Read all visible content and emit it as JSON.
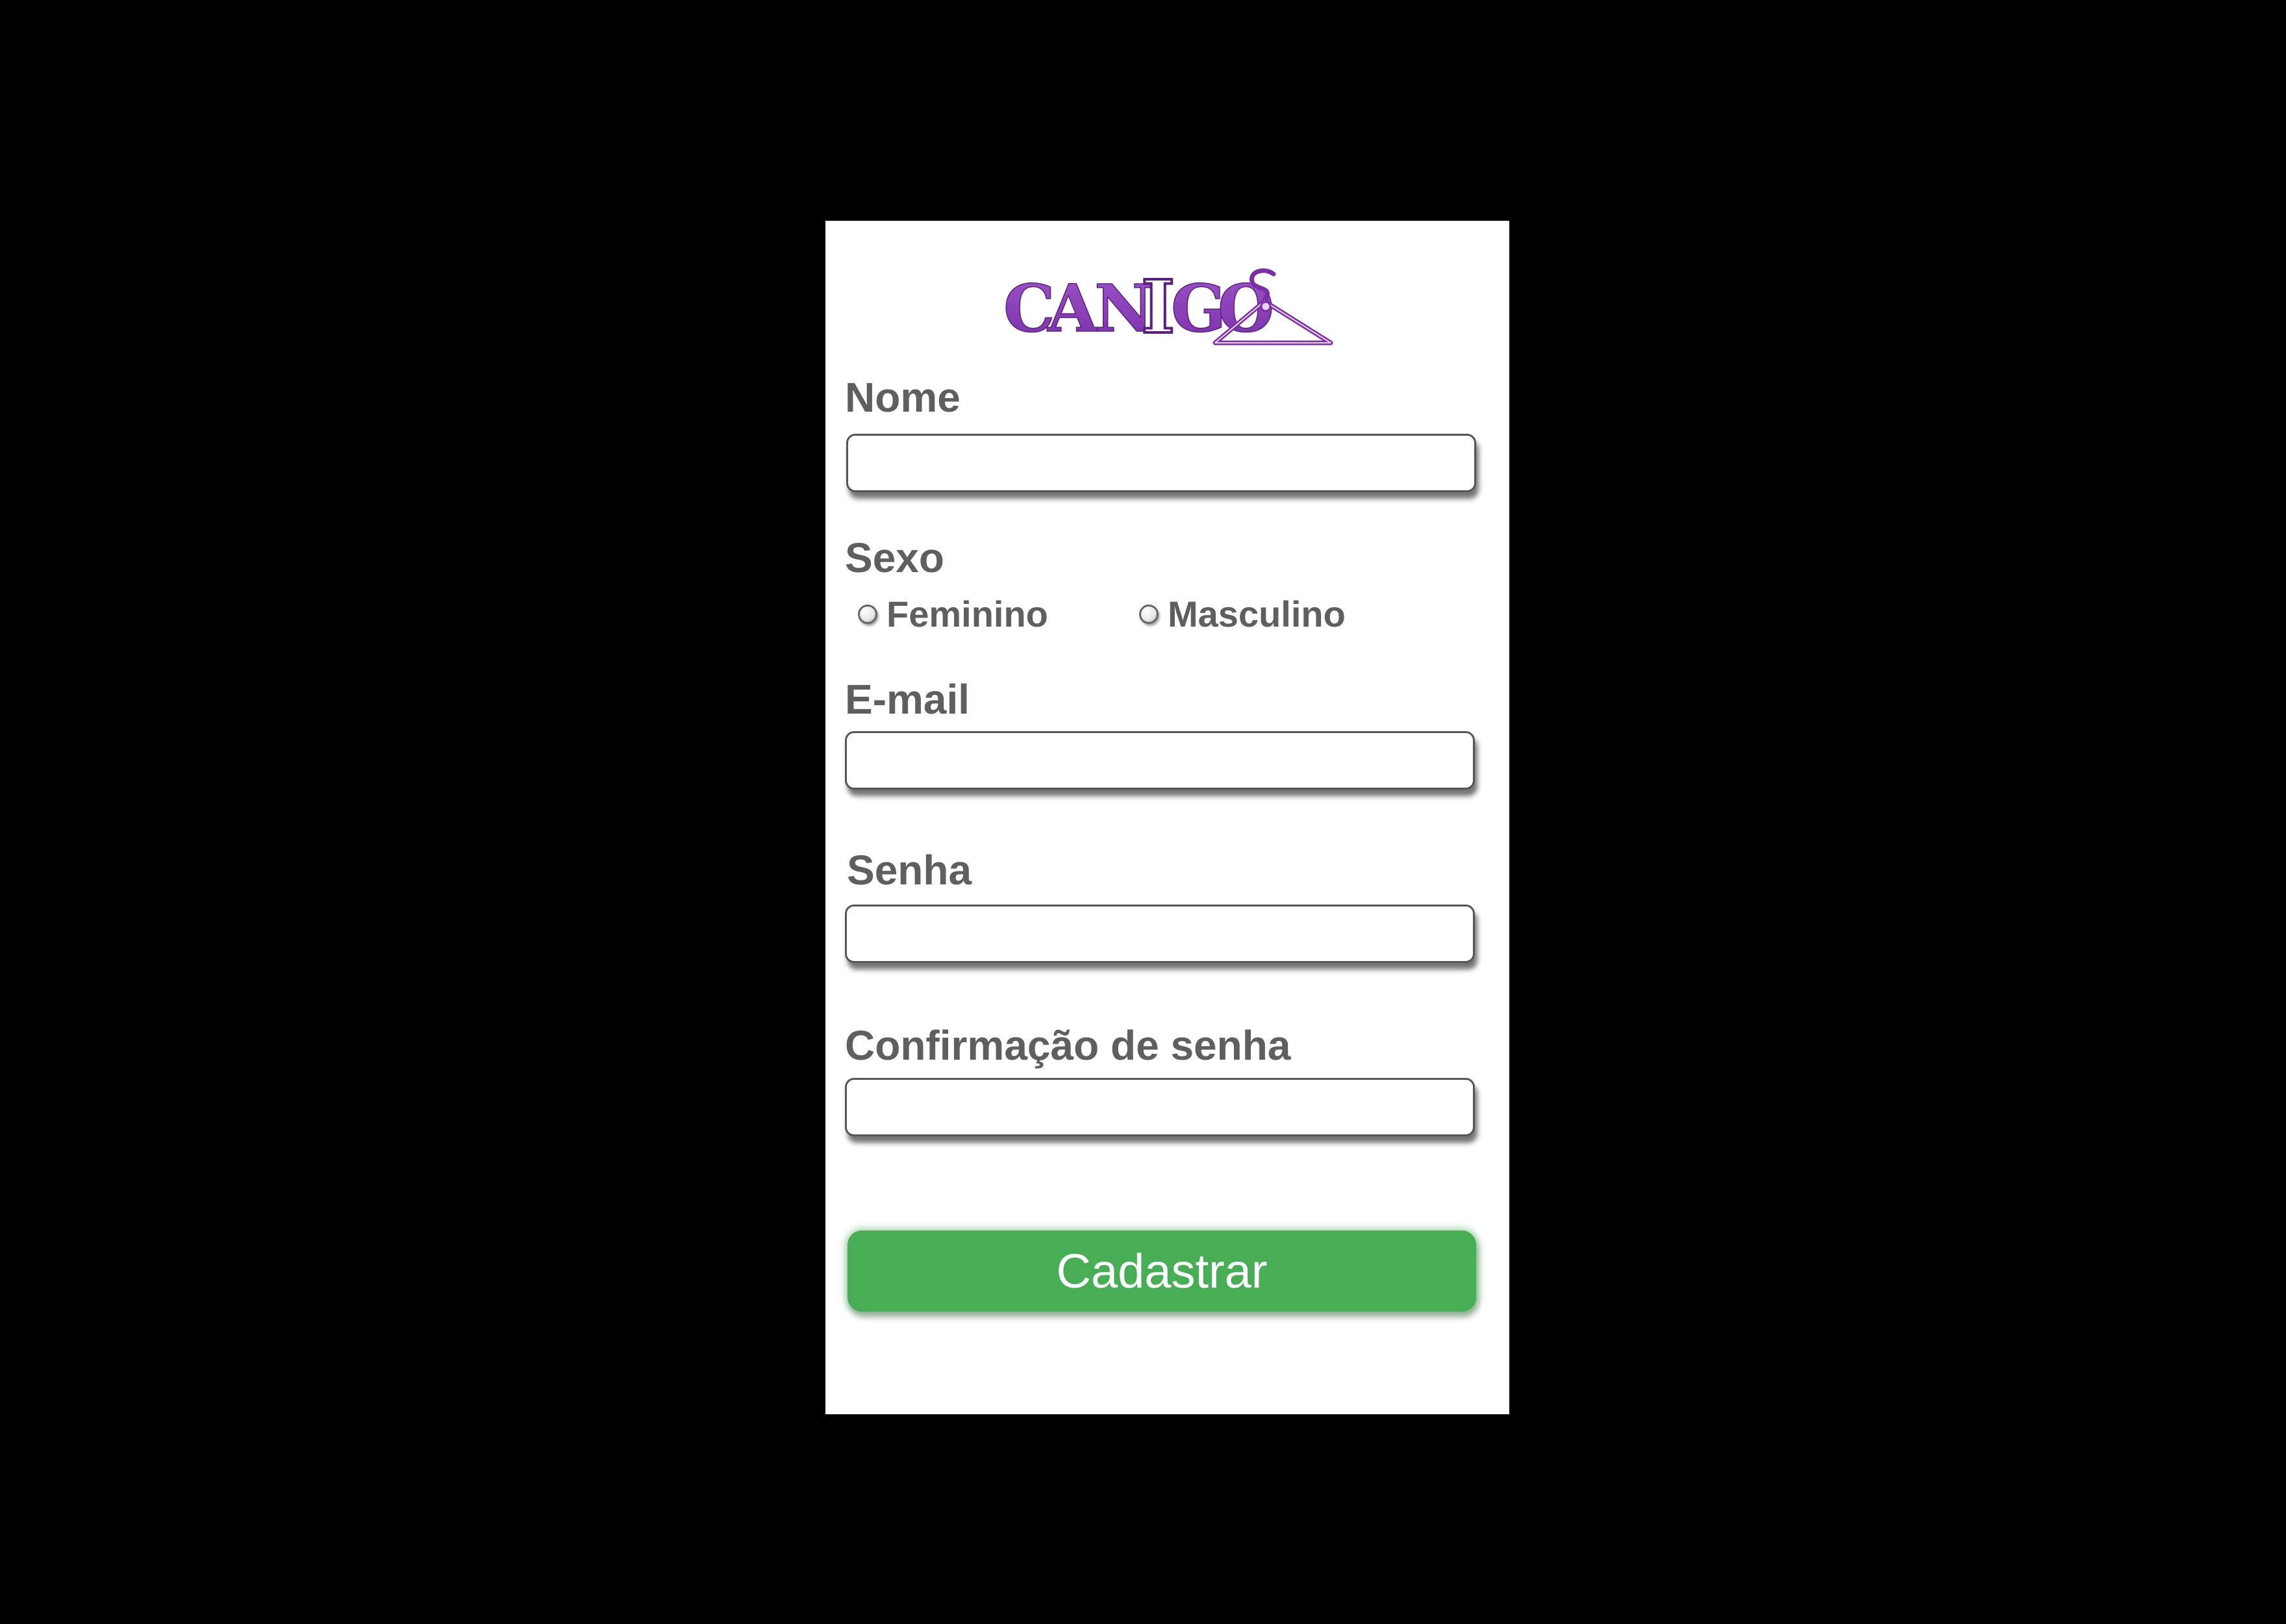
{
  "app": {
    "logo_text": "CANIGO"
  },
  "form": {
    "nome_label": "Nome",
    "nome_value": "",
    "sexo_label": "Sexo",
    "sexo_options": [
      "Feminino",
      "Masculino"
    ],
    "email_label": "E-mail",
    "email_value": "",
    "senha_label": "Senha",
    "senha_value": "",
    "confirm_label": "Confirmação de senha",
    "confirm_value": "",
    "submit_label": "Cadastrar"
  },
  "icons": {
    "logo": "hanger-icon"
  },
  "colors": {
    "background": "#000000",
    "card": "#ffffff",
    "brand_purple": "#8b3fb5",
    "label_gray": "#5f5f5f",
    "submit_green": "#48ae56"
  }
}
